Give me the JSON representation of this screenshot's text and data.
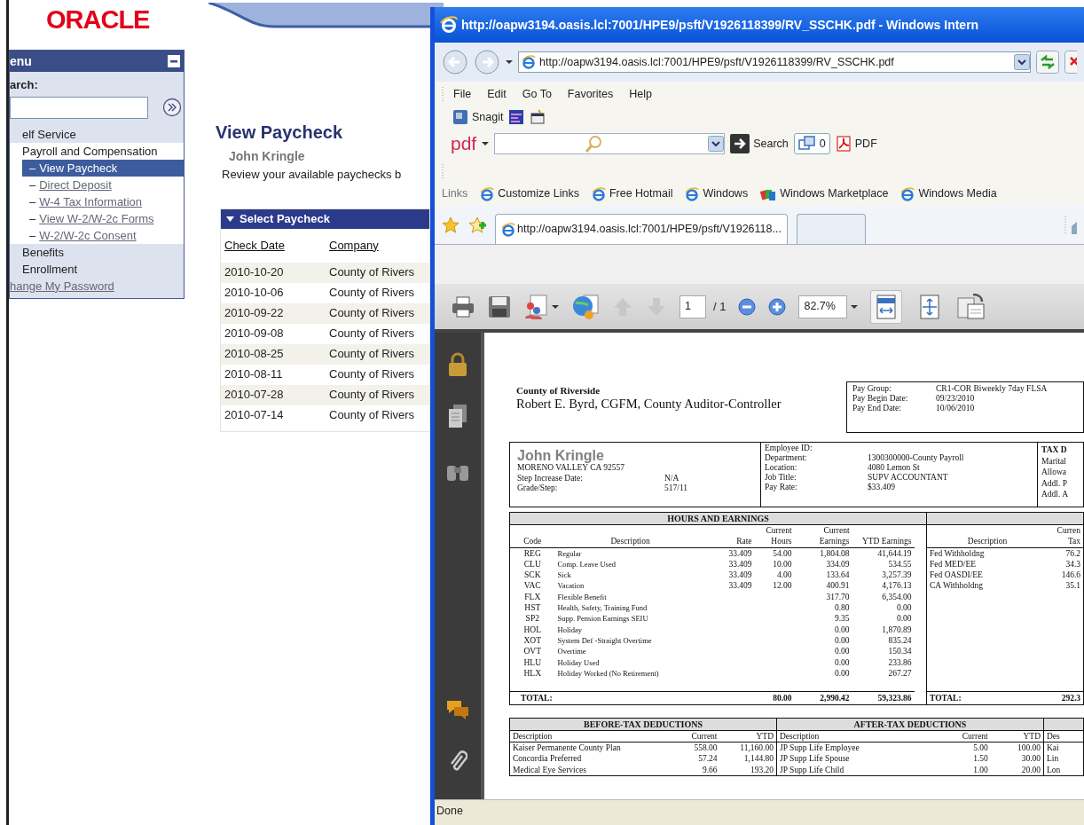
{
  "portal": {
    "logo": "ORACLE",
    "menu": {
      "title": "enu",
      "search_label": "arch:",
      "items": [
        {
          "kind": "folder",
          "label": "elf Service"
        },
        {
          "kind": "folder",
          "label": "Payroll and Compensation",
          "children": [
            {
              "marker": "–",
              "label": "View Paycheck",
              "selected": true
            },
            {
              "marker": "–",
              "label": "Direct Deposit",
              "selected": false
            },
            {
              "marker": "–",
              "label": "W-4 Tax Information",
              "selected": false
            },
            {
              "marker": "–",
              "label": "View W-2/W-2c Forms",
              "selected": false
            },
            {
              "marker": "–",
              "label": "W-2/W-2c Consent",
              "selected": false
            }
          ]
        },
        {
          "kind": "folder",
          "label": "Benefits"
        },
        {
          "kind": "folder",
          "label": "Enrollment"
        },
        {
          "kind": "link",
          "label": "hange My Password"
        }
      ]
    },
    "heading": "View Paycheck",
    "employee": "John Kringle",
    "intro": "Review your available paychecks b",
    "paycheck_list": {
      "title": "Select Paycheck",
      "columns": [
        "Check Date",
        "Company"
      ],
      "rows": [
        {
          "check_date": "2010-10-20",
          "company": "County of Rivers"
        },
        {
          "check_date": "2010-10-06",
          "company": "County of Rivers"
        },
        {
          "check_date": "2010-09-22",
          "company": "County of Rivers"
        },
        {
          "check_date": "2010-09-08",
          "company": "County of Rivers"
        },
        {
          "check_date": "2010-08-25",
          "company": "County of Rivers"
        },
        {
          "check_date": "2010-08-11",
          "company": "County of Rivers"
        },
        {
          "check_date": "2010-07-28",
          "company": "County of Rivers"
        },
        {
          "check_date": "2010-07-14",
          "company": "County of Rivers"
        }
      ]
    }
  },
  "browser": {
    "title": "http://oapw3194.oasis.lcl:7001/HPE9/psft/V1926118399/RV_SSCHK.pdf - Windows Intern",
    "address": "http://oapw3194.oasis.lcl:7001/HPE9/psft/V1926118399/RV_SSCHK.pdf",
    "menu": [
      "File",
      "Edit",
      "Go To",
      "Favorites",
      "Help"
    ],
    "snagit": "Snagit",
    "pdf_bar": {
      "logo": "pdf",
      "search_label": "Search",
      "count": "0",
      "pdf_label": "PDF"
    },
    "links_label": "Links",
    "links": [
      {
        "kind": "page",
        "label": "Customize Links"
      },
      {
        "kind": "page",
        "label": "Free Hotmail"
      },
      {
        "kind": "page",
        "label": "Windows"
      },
      {
        "kind": "store",
        "label": "Windows Marketplace"
      },
      {
        "kind": "page",
        "label": "Windows Media"
      }
    ],
    "tabs": [
      {
        "label": "http://oapw3194.oasis.lcl:7001/HPE9/psft/V1926118...",
        "selected": true
      },
      {
        "selected": false
      }
    ],
    "viewer": {
      "page": "1",
      "page_total": "/ 1",
      "zoom": "82.7%",
      "view_modes": [
        {
          "selected": true
        },
        {
          "selected": false
        }
      ]
    },
    "document": {
      "org": "County of Riverside",
      "official": "Robert E. Byrd, CGFM, County Auditor-Controller",
      "pay_info": [
        {
          "label": "Pay Group:",
          "value": "CR1-COR Biweekly 7day FLSA"
        },
        {
          "label": "Pay Begin Date:",
          "value": "09/23/2010"
        },
        {
          "label": "Pay End Date:",
          "value": "10/06/2010"
        }
      ],
      "employee_name": "John Kringle",
      "address": "MORENO VALLEY CA  92557",
      "employee_info": [
        {
          "label": "Step Increase Date:",
          "value": "N/A"
        },
        {
          "label": "Grade/Step:",
          "value": "517/11"
        }
      ],
      "job_info": [
        {
          "label": "Employee ID:"
        },
        {
          "label": "Department:",
          "value": "1300300000-County Payroll"
        },
        {
          "label": "Location:",
          "value": "4080 Lemon St"
        },
        {
          "label": "Job Title:",
          "value": "SUPV ACCOUNTANT"
        },
        {
          "label": "Pay Rate:",
          "value": "$33.409"
        }
      ],
      "tax_info": [
        "TAX D",
        "Marital",
        "Allowa",
        "Addl. P",
        "Addl. A"
      ],
      "earnings": {
        "title": "HOURS AND EARNINGS",
        "columns": [
          "Code",
          "Description",
          "Rate",
          "Current Hours",
          "Current Earnings",
          "YTD Earnings"
        ],
        "rows": [
          {
            "code": "REG",
            "description": "Regular",
            "rate": "33.409",
            "hours": "54.00",
            "earnings": "1,804.08",
            "ytd": "41,644.19"
          },
          {
            "code": "CLU",
            "description": "Comp. Leave Used",
            "rate": "33.409",
            "hours": "10.00",
            "earnings": "334.09",
            "ytd": "534.55"
          },
          {
            "code": "SCK",
            "description": "Sick",
            "rate": "33.409",
            "hours": "4.00",
            "earnings": "133.64",
            "ytd": "3,257.39"
          },
          {
            "code": "VAC",
            "description": "Vacation",
            "rate": "33.409",
            "hours": "12.00",
            "earnings": "400.91",
            "ytd": "4,176.13"
          },
          {
            "code": "FLX",
            "description": "Flexible Benefit",
            "earnings": "317.70",
            "ytd": "6,354.00"
          },
          {
            "code": "HST",
            "description": "Health, Safety, Training Fund",
            "earnings": "0.80",
            "ytd": "0.00"
          },
          {
            "code": "SP2",
            "description": "Supp. Pension Earnings SEIU",
            "earnings": "9.35",
            "ytd": "0.00"
          },
          {
            "code": "HOL",
            "description": "Holiday",
            "earnings": "0.00",
            "ytd": "1,870.89"
          },
          {
            "code": "XOT",
            "description": "System Def -Straight Overtime",
            "earnings": "0.00",
            "ytd": "835.24"
          },
          {
            "code": "OVT",
            "description": "Overtime",
            "earnings": "0.00",
            "ytd": "150.34"
          },
          {
            "code": "HLU",
            "description": "Holiday Used",
            "earnings": "0.00",
            "ytd": "233.86"
          },
          {
            "code": "HLX",
            "description": "Holiday Worked (No Retirement)",
            "earnings": "0.00",
            "ytd": "267.27"
          }
        ],
        "total": {
          "label": "TOTAL:",
          "hours": "80.00",
          "earnings": "2,990.42",
          "ytd": "59,323.86"
        }
      },
      "taxes": {
        "columns": [
          "Description",
          "Curren Tax"
        ],
        "rows": [
          {
            "description": "Fed Withholdng",
            "amount": "76.2"
          },
          {
            "description": "Fed MED/EE",
            "amount": "34.3"
          },
          {
            "description": "Fed OASDI/EE",
            "amount": "146.6"
          },
          {
            "description": "CA Withholdng",
            "amount": "35.1"
          }
        ],
        "total": {
          "label": "TOTAL:",
          "amount": "292.3"
        }
      },
      "deductions": [
        {
          "title": "BEFORE-TAX DEDUCTIONS",
          "columns": [
            "Description",
            "Current",
            "YTD"
          ],
          "rows": [
            [
              "Kaiser Permanente County Plan",
              "558.00",
              "11,160.00"
            ],
            [
              "Concordia Preferred",
              "57.24",
              "1,144.80"
            ],
            [
              "Medical Eye Services",
              "9.66",
              "193.20"
            ]
          ]
        },
        {
          "title": "AFTER-TAX DEDUCTIONS",
          "columns": [
            "Description",
            "Current",
            "YTD"
          ],
          "rows": [
            [
              "JP Supp Life Employee",
              "5.00",
              "100.00"
            ],
            [
              "JP Supp Life Spouse",
              "1.50",
              "30.00"
            ],
            [
              "JP Supp Life Child",
              "1.00",
              "20.00"
            ]
          ]
        },
        {
          "columns": [
            "Des"
          ],
          "rows": [
            [
              "Kai"
            ],
            [
              "Lin"
            ],
            [
              "Lon"
            ]
          ]
        }
      ]
    },
    "status": "Done"
  }
}
